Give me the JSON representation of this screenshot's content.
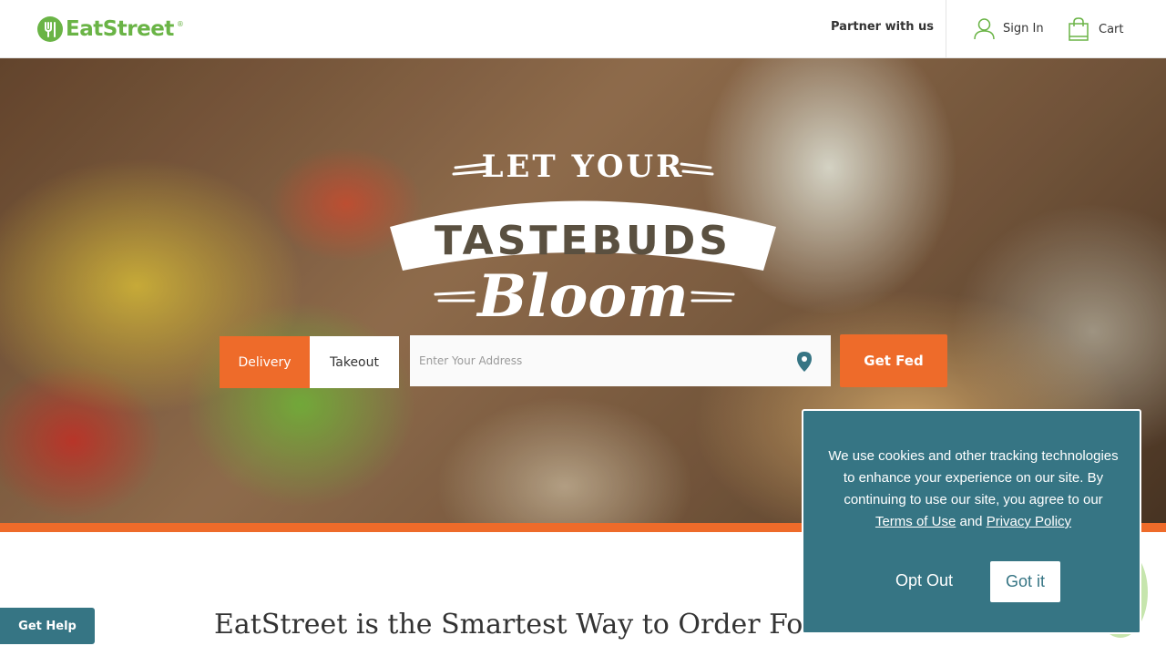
{
  "header": {
    "logo_text": "EatStreet",
    "logo_registered": "®",
    "partner_label": "Partner with us",
    "signin_label": "Sign In",
    "cart_label": "Cart"
  },
  "hero": {
    "tagline_line1": "LET YOUR",
    "tagline_line2": "TASTEBUDS",
    "tagline_line3": "Bloom",
    "delivery_label": "Delivery",
    "takeout_label": "Takeout",
    "address_placeholder": "Enter Your Address",
    "get_fed_label": "Get Fed"
  },
  "main": {
    "headline": "EatStreet is the Smartest Way to Order Fo"
  },
  "help": {
    "label": "Get Help"
  },
  "cookie": {
    "text_before": "We use cookies and other tracking technologies to enhance your experience on our site. By continuing to use our site, you agree to our ",
    "terms_label": "Terms of Use",
    "text_and": " and ",
    "privacy_label": "Privacy Policy",
    "opt_out_label": "Opt Out",
    "got_it_label": "Got it"
  },
  "colors": {
    "brand_green": "#6ab446",
    "accent_orange": "#ee6b2a",
    "teal": "#367584"
  }
}
